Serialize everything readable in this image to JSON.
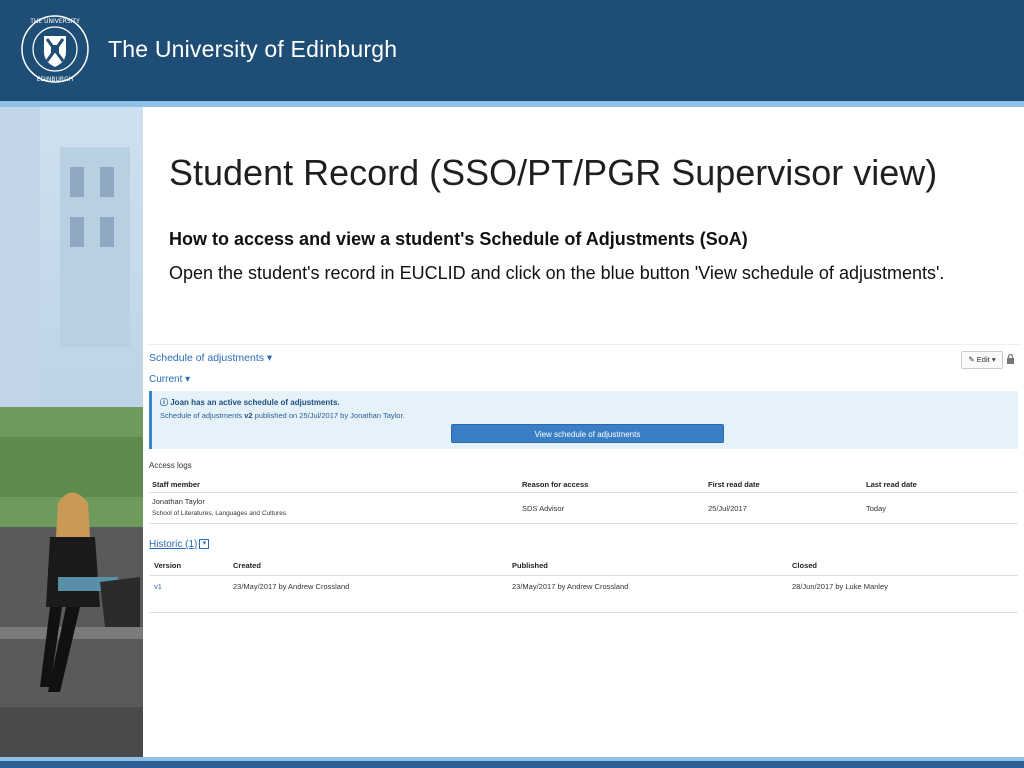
{
  "header": {
    "university_name": "The University of Edinburgh",
    "crest_icon": "university-crest-icon",
    "colors": {
      "banner": "#1e4d76",
      "stripe": "#8fc1e8"
    }
  },
  "slide": {
    "title": "Student Record (SSO/PT/PGR Supervisor view)",
    "subheading": "How to access and view a student's Schedule of Adjustments (SoA)",
    "body": "Open the student's record in EUCLID and click on the blue button 'View schedule of adjustments'."
  },
  "euclid": {
    "section_label": "Schedule of adjustments",
    "edit_label": "Edit",
    "current_label": "Current",
    "info": {
      "headline": "Joan has an active schedule of adjustments.",
      "link_text": "Schedule of adjustments",
      "version": "v2",
      "published_text": "published on 25/Jul/2017 by Jonathan Taylor."
    },
    "view_button_label": "View schedule of adjustments",
    "access_logs": {
      "label": "Access logs",
      "columns": [
        "Staff member",
        "Reason for access",
        "First read date",
        "Last read date"
      ],
      "rows": [
        {
          "staff": "Jonathan Taylor",
          "school": "School of Literatures, Languages and Cultures",
          "reason": "SDS Advisor",
          "first_read": "25/Jul/2017",
          "last_read": "Today"
        }
      ]
    },
    "historic": {
      "label": "Historic (1)",
      "columns": [
        "Version",
        "Created",
        "Published",
        "Closed"
      ],
      "rows": [
        {
          "version": "v1",
          "created": "23/May/2017 by Andrew Crossland",
          "published": "23/May/2017 by Andrew Crossland",
          "closed": "28/Jun/2017 by Luke Manley"
        }
      ]
    },
    "colors": {
      "link": "#2a6db5",
      "button": "#3a7fc5",
      "info_bg": "#e6f2f9"
    }
  }
}
